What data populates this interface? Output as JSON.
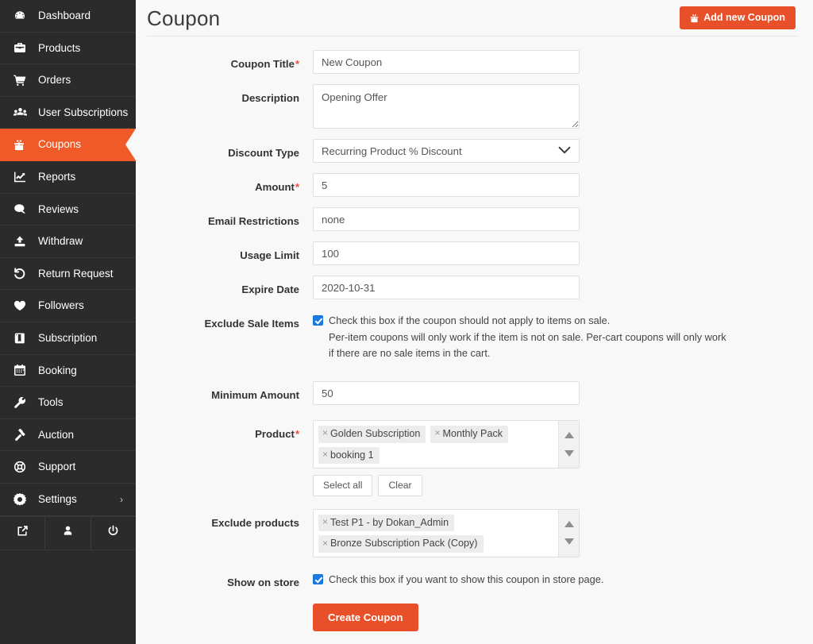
{
  "sidebar": {
    "items": [
      {
        "label": "Dashboard",
        "icon": "dashboard-icon",
        "active": false,
        "chevron": false
      },
      {
        "label": "Products",
        "icon": "briefcase-icon",
        "active": false,
        "chevron": false
      },
      {
        "label": "Orders",
        "icon": "cart-icon",
        "active": false,
        "chevron": false
      },
      {
        "label": "User Subscriptions",
        "icon": "users-icon",
        "active": false,
        "chevron": false
      },
      {
        "label": "Coupons",
        "icon": "coupon-gift-icon",
        "active": true,
        "chevron": false
      },
      {
        "label": "Reports",
        "icon": "chart-line-icon",
        "active": false,
        "chevron": false
      },
      {
        "label": "Reviews",
        "icon": "comment-icon",
        "active": false,
        "chevron": false
      },
      {
        "label": "Withdraw",
        "icon": "upload-icon",
        "active": false,
        "chevron": false
      },
      {
        "label": "Return Request",
        "icon": "undo-arrow-icon",
        "active": false,
        "chevron": false
      },
      {
        "label": "Followers",
        "icon": "heart-icon",
        "active": false,
        "chevron": false
      },
      {
        "label": "Subscription",
        "icon": "book-icon",
        "active": false,
        "chevron": false
      },
      {
        "label": "Booking",
        "icon": "calendar-icon",
        "active": false,
        "chevron": false
      },
      {
        "label": "Tools",
        "icon": "wrench-icon",
        "active": false,
        "chevron": false
      },
      {
        "label": "Auction",
        "icon": "gavel-icon",
        "active": false,
        "chevron": false
      },
      {
        "label": "Support",
        "icon": "life-ring-icon",
        "active": false,
        "chevron": false
      },
      {
        "label": "Settings",
        "icon": "gear-icon",
        "active": false,
        "chevron": true
      }
    ],
    "chevron_glyph": "›",
    "bottom_actions": [
      {
        "icon": "external-link-icon"
      },
      {
        "icon": "user-icon"
      },
      {
        "icon": "power-icon"
      }
    ]
  },
  "header": {
    "title": "Coupon",
    "add_button_label": "Add new Coupon",
    "add_button_icon": "coupon-gift-icon"
  },
  "form": {
    "coupon_title": {
      "label": "Coupon Title",
      "required": true,
      "value": "New Coupon",
      "placeholder": "New Coupon"
    },
    "description": {
      "label": "Description",
      "required": false,
      "value": "Opening Offer",
      "placeholder": "Opening Offer"
    },
    "discount_type": {
      "label": "Discount Type",
      "required": false,
      "value": "Recurring Product % Discount",
      "options": [
        "Recurring Product % Discount"
      ]
    },
    "amount": {
      "label": "Amount",
      "required": true,
      "value": "5",
      "placeholder": "5"
    },
    "email_restrictions": {
      "label": "Email Restrictions",
      "required": false,
      "value": "none",
      "placeholder": "none"
    },
    "usage_limit": {
      "label": "Usage Limit",
      "required": false,
      "value": "100",
      "placeholder": "100"
    },
    "expire_date": {
      "label": "Expire Date",
      "required": false,
      "value": "2020-10-31",
      "placeholder": "2020-10-31"
    },
    "exclude_sale_items": {
      "label": "Exclude Sale Items",
      "checked": true,
      "description_line1": "Check this box if the coupon should not apply to items on sale.",
      "description_line2": "Per-item coupons will only work if the item is not on sale. Per-cart coupons will only work if there are no sale items in the cart."
    },
    "minimum_amount": {
      "label": "Minimum Amount",
      "required": false,
      "value": "50",
      "placeholder": "50"
    },
    "product": {
      "label": "Product",
      "required": true,
      "tags": [
        "Golden Subscription",
        "Monthly Pack",
        "booking 1"
      ],
      "remove_glyph": "×",
      "select_all_label": "Select all",
      "clear_label": "Clear"
    },
    "exclude_products": {
      "label": "Exclude products",
      "required": false,
      "tags": [
        "Test P1 - by Dokan_Admin",
        "Bronze Subscription Pack (Copy)"
      ],
      "remove_glyph": "×"
    },
    "show_on_store": {
      "label": "Show on store",
      "checked": true,
      "description": "Check this box if you want to show this coupon in store page."
    },
    "submit_label": "Create Coupon"
  },
  "colors": {
    "accent_orange": "#e8502a",
    "sidebar_bg": "#2b2b2b",
    "active_nav": "#f05a28",
    "checkbox_blue": "#1a7ae0",
    "page_bg": "#f8f8f8"
  }
}
